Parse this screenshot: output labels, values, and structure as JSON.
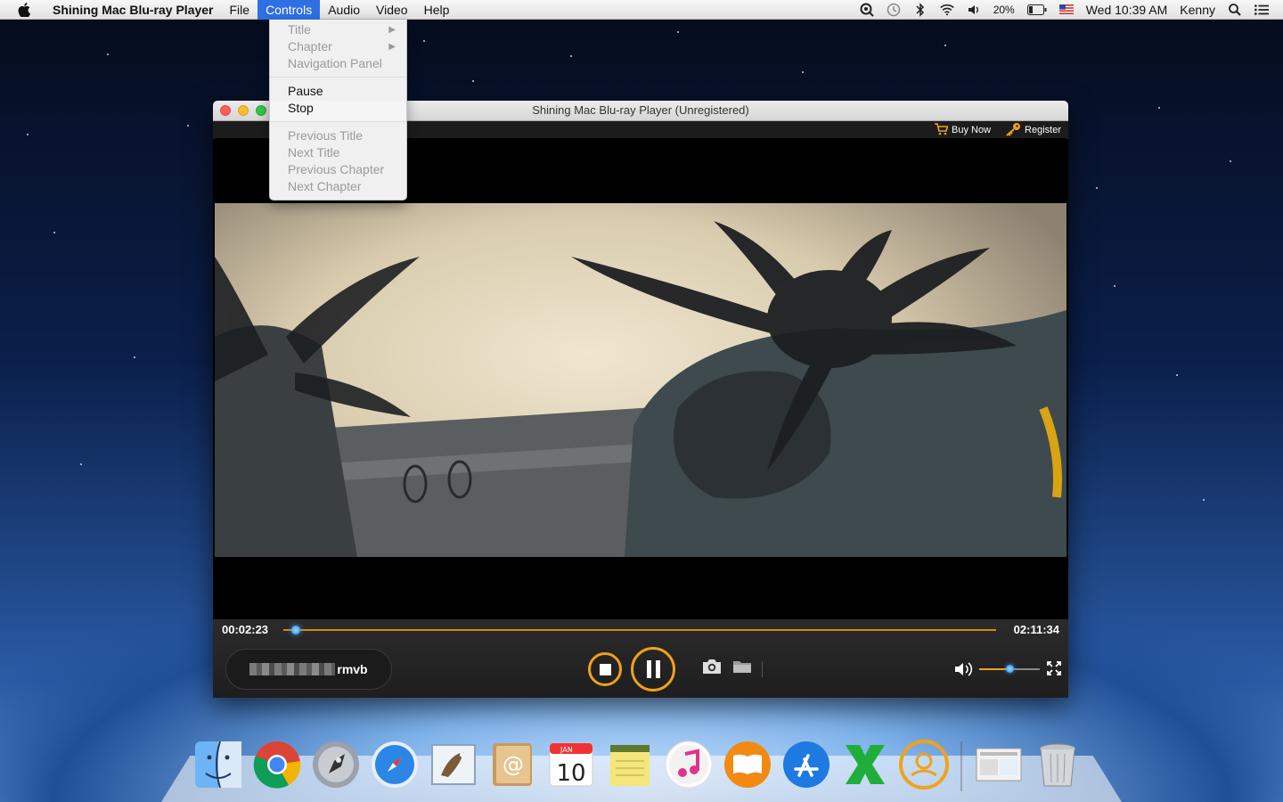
{
  "menubar": {
    "app_name": "Shining Mac Blu-ray Player",
    "menus": [
      "File",
      "Controls",
      "Audio",
      "Video",
      "Help"
    ],
    "active_menu": "Controls",
    "status": {
      "battery": "20%",
      "clock": "Wed 10:39 AM",
      "user": "Kenny"
    }
  },
  "controls_menu": {
    "group1": [
      {
        "label": "Title",
        "submenu": true
      },
      {
        "label": "Chapter",
        "submenu": true
      },
      {
        "label": "Navigation Panel",
        "submenu": false
      }
    ],
    "group2": [
      {
        "label": "Pause"
      },
      {
        "label": "Stop"
      }
    ],
    "group3": [
      {
        "label": "Previous Title"
      },
      {
        "label": "Next Title"
      },
      {
        "label": "Previous Chapter"
      },
      {
        "label": "Next Chapter"
      }
    ]
  },
  "window": {
    "title": "Shining Mac Blu-ray Player (Unregistered)",
    "buy_now": "Buy Now",
    "register": "Register"
  },
  "player": {
    "current_time": "00:02:23",
    "duration": "02:11:34",
    "progress_fraction": 0.018,
    "volume_fraction": 0.5,
    "file_suffix": "rmvb"
  },
  "dock": {
    "apps": [
      "finder-icon",
      "chrome-icon",
      "launchpad-icon",
      "safari-icon",
      "mail-icon",
      "contacts-icon",
      "calendar-icon",
      "notes-icon",
      "itunes-icon",
      "ibooks-icon",
      "app-store-icon",
      "excel-icon",
      "player-icon"
    ],
    "calendar": {
      "month": "JAN",
      "day": "10"
    }
  },
  "colors": {
    "accent": "#f0a11c",
    "menu_highlight": "#2f6fe3",
    "knob": "#1f86ff"
  }
}
